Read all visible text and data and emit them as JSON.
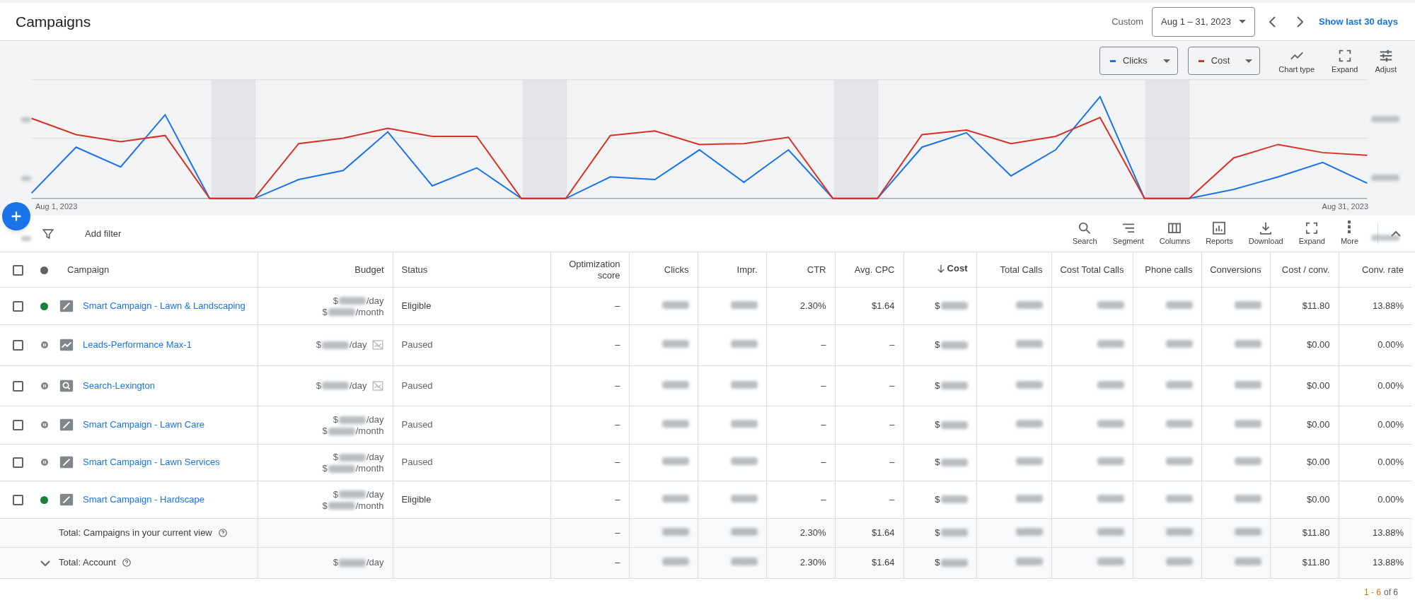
{
  "header": {
    "title": "Campaigns",
    "range_label": "Custom",
    "date_range": "Aug 1 – 31, 2023",
    "show_last": "Show last 30 days"
  },
  "chart": {
    "metrics": [
      {
        "label": "Clicks",
        "color": "#1a73e8"
      },
      {
        "label": "Cost",
        "color": "#d93025"
      }
    ],
    "tools": [
      {
        "label": "Chart type"
      },
      {
        "label": "Expand"
      },
      {
        "label": "Adjust"
      }
    ],
    "start_label": "Aug 1, 2023",
    "end_label": "Aug 31, 2023"
  },
  "toolbar": {
    "filter_label": "Add filter",
    "tools": [
      {
        "label": "Search"
      },
      {
        "label": "Segment"
      },
      {
        "label": "Columns"
      },
      {
        "label": "Reports"
      },
      {
        "label": "Download"
      },
      {
        "label": "Expand"
      },
      {
        "label": "More"
      }
    ]
  },
  "table": {
    "header_checked": false,
    "columns": [
      {
        "label": "Campaign",
        "sorted": false
      },
      {
        "label": "Budget",
        "sorted": false
      },
      {
        "label": "Status",
        "sorted": false
      },
      {
        "label": "Optimization score",
        "sorted": false
      },
      {
        "label": "Clicks",
        "sorted": false
      },
      {
        "label": "Impr.",
        "sorted": false
      },
      {
        "label": "CTR",
        "sorted": false
      },
      {
        "label": "Avg. CPC",
        "sorted": false
      },
      {
        "label": "Cost",
        "sorted": true
      },
      {
        "label": "Total Calls",
        "sorted": false
      },
      {
        "label": "Cost Total Calls",
        "sorted": false
      },
      {
        "label": "Phone calls",
        "sorted": false
      },
      {
        "label": "Conversions",
        "sorted": false
      },
      {
        "label": "Cost / conv.",
        "sorted": false
      },
      {
        "label": "Conv. rate",
        "sorted": false
      }
    ],
    "rows": [
      {
        "checked": false,
        "enabled": true,
        "kind": "smart",
        "name": "Smart Campaign - Lawn & Landscaping",
        "budget": [
          {
            "prefix": "$",
            "blurred": true,
            "suffix": "/day"
          },
          {
            "prefix": "$",
            "blurred": true,
            "suffix": "/month"
          }
        ],
        "budget_flag": false,
        "status": "Eligible",
        "metrics": [
          "–",
          {
            "blurred": true
          },
          {
            "blurred": true
          },
          "2.30%",
          "$1.64",
          {
            "prefix": "$",
            "blurred": true
          },
          {
            "blurred": true
          },
          {
            "blurred": true
          },
          {
            "blurred": true
          },
          {
            "blurred": true
          },
          "$11.80",
          "13.88%"
        ]
      },
      {
        "checked": false,
        "enabled": false,
        "kind": "pmax",
        "name": "Leads-Performance Max-1",
        "budget": [
          {
            "prefix": "$",
            "blurred": true,
            "suffix": "/day"
          }
        ],
        "budget_flag": true,
        "status": "Paused",
        "metrics": [
          "–",
          {
            "blurred": true
          },
          {
            "blurred": true
          },
          "–",
          "–",
          {
            "prefix": "$",
            "blurred": true
          },
          {
            "blurred": true
          },
          {
            "blurred": true
          },
          {
            "blurred": true
          },
          {
            "blurred": true
          },
          "$0.00",
          "0.00%"
        ]
      },
      {
        "checked": false,
        "enabled": false,
        "kind": "search",
        "name": "Search-Lexington",
        "budget": [
          {
            "prefix": "$",
            "blurred": true,
            "suffix": "/day"
          }
        ],
        "budget_flag": true,
        "status": "Paused",
        "metrics": [
          "–",
          {
            "blurred": true
          },
          {
            "blurred": true
          },
          "–",
          "–",
          {
            "prefix": "$",
            "blurred": true
          },
          {
            "blurred": true
          },
          {
            "blurred": true
          },
          {
            "blurred": true
          },
          {
            "blurred": true
          },
          "$0.00",
          "0.00%"
        ]
      },
      {
        "checked": false,
        "enabled": false,
        "kind": "smart",
        "name": "Smart Campaign - Lawn Care",
        "budget": [
          {
            "prefix": "$",
            "blurred": true,
            "suffix": "/day"
          },
          {
            "prefix": "$",
            "blurred": true,
            "suffix": "/month"
          }
        ],
        "budget_flag": false,
        "status": "Paused",
        "metrics": [
          "–",
          {
            "blurred": true
          },
          {
            "blurred": true
          },
          "–",
          "–",
          {
            "prefix": "$",
            "blurred": true
          },
          {
            "blurred": true
          },
          {
            "blurred": true
          },
          {
            "blurred": true
          },
          {
            "blurred": true
          },
          "$0.00",
          "0.00%"
        ]
      },
      {
        "checked": false,
        "enabled": false,
        "kind": "smart",
        "name": "Smart Campaign - Lawn Services",
        "budget": [
          {
            "prefix": "$",
            "blurred": true,
            "suffix": "/day"
          },
          {
            "prefix": "$",
            "blurred": true,
            "suffix": "/month"
          }
        ],
        "budget_flag": false,
        "status": "Paused",
        "metrics": [
          "–",
          {
            "blurred": true
          },
          {
            "blurred": true
          },
          "–",
          "–",
          {
            "prefix": "$",
            "blurred": true
          },
          {
            "blurred": true
          },
          {
            "blurred": true
          },
          {
            "blurred": true
          },
          {
            "blurred": true
          },
          "$0.00",
          "0.00%"
        ]
      },
      {
        "checked": false,
        "enabled": true,
        "kind": "smart",
        "name": "Smart Campaign - Hardscape",
        "budget": [
          {
            "prefix": "$",
            "blurred": true,
            "suffix": "/day"
          },
          {
            "prefix": "$",
            "blurred": true,
            "suffix": "/month"
          }
        ],
        "budget_flag": false,
        "status": "Eligible",
        "metrics": [
          "–",
          {
            "blurred": true
          },
          {
            "blurred": true
          },
          "–",
          "–",
          {
            "prefix": "$",
            "blurred": true
          },
          {
            "blurred": true
          },
          {
            "blurred": true
          },
          {
            "blurred": true
          },
          {
            "blurred": true
          },
          "$0.00",
          "0.00%"
        ]
      }
    ],
    "totals": [
      {
        "kind": "view",
        "label": "Total: Campaigns in your current view",
        "metrics": [
          "–",
          {
            "blurred": true
          },
          {
            "blurred": true
          },
          "2.30%",
          "$1.64",
          {
            "prefix": "$",
            "blurred": true
          },
          {
            "blurred": true
          },
          {
            "blurred": true
          },
          {
            "blurred": true
          },
          {
            "blurred": true
          },
          "$11.80",
          "13.88%"
        ]
      },
      {
        "kind": "account",
        "label": "Total: Account",
        "budget": [
          {
            "prefix": "$",
            "blurred": true,
            "suffix": "/day"
          }
        ],
        "metrics": [
          "–",
          {
            "blurred": true
          },
          {
            "blurred": true
          },
          "2.30%",
          "$1.64",
          {
            "prefix": "$",
            "blurred": true
          },
          {
            "blurred": true
          },
          {
            "blurred": true
          },
          {
            "blurred": true
          },
          {
            "blurred": true
          },
          "$11.80",
          "13.88%"
        ]
      }
    ]
  },
  "pagination": {
    "range": "1 - 6",
    "total": "of 6"
  }
}
